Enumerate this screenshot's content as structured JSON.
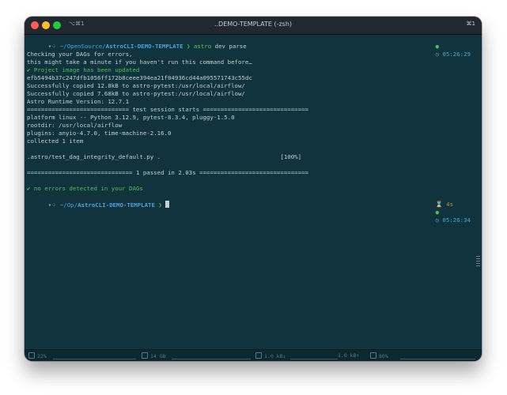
{
  "window": {
    "title": "..DEMO-TEMPLATE (-zsh)",
    "shortcut_left": "⌥⌘1",
    "shortcut_right": "⌘1"
  },
  "prompt1": {
    "icon": "▾⁘",
    "path_prefix": "~/OpenSource/",
    "path_dir": "AstroCLI-DEMO-TEMPLATE",
    "arrow": "❯",
    "cmd_name": "astro",
    "cmd_args": " dev parse",
    "status_dot": "●",
    "time": "◷ 05:26:29"
  },
  "output": [
    "Checking your DAGs for errors,",
    "this might take a minute if you haven't run this command before…",
    "✔ Project image has been updated",
    "efb5494b37c247dfb1056ff172b8ceee394ea21f04936cd44a095571743c55dc",
    "Successfully copied 12.8kB to astro-pytest:/usr/local/airflow/",
    "Successfully copied 7.68kB to astro-pytest:/usr/local/airflow/",
    "Astro Runtime Version: 12.7.1",
    "============================= test session starts ==============================",
    "platform linux -- Python 3.12.9, pytest-8.3.4, pluggy-1.5.0",
    "rootdir: /usr/local/airflow",
    "plugins: anyio-4.7.0, time-machine-2.16.0",
    "collected 1 item",
    "",
    ".astro/test_dag_integrity_default.py .                                  [100%]",
    "",
    "============================== 1 passed in 2.03s ===============================",
    "",
    "✔ no errors detected in your DAGs"
  ],
  "prompt2": {
    "icon": "▾⁘",
    "path_prefix": "~/Op/",
    "path_dir": "AstroCLI-DEMO-TEMPLATE",
    "arrow": "❯",
    "duration": "⌛ 4s",
    "status_dot": "●",
    "time": "◷ 05:26:34"
  },
  "statusbar": {
    "cpu": "22%",
    "memory": "14 GB",
    "net_down": "1.0 kB↓",
    "net_up": "1.0 kB↑",
    "battery": "80%"
  },
  "colors": {
    "terminal_bg": "#11333d",
    "text": "#c3cfd3",
    "path": "#4aa3d8",
    "success": "#4fbf5a"
  }
}
